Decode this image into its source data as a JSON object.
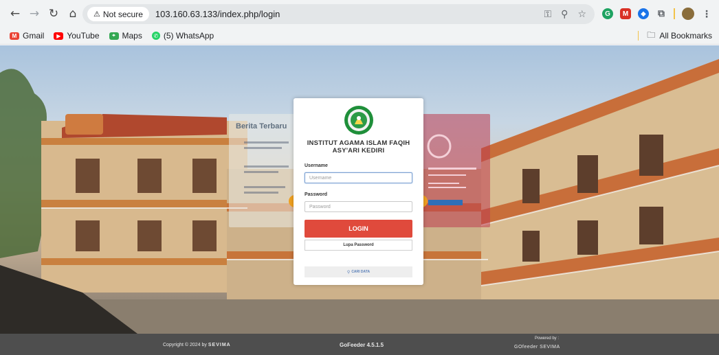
{
  "browser": {
    "security_label": "Not secure",
    "url": "103.160.63.133/index.php/login",
    "bookmarks": [
      {
        "label": "Gmail",
        "color": "#ea4335"
      },
      {
        "label": "YouTube",
        "color": "#ff0000"
      },
      {
        "label": "Maps",
        "color": "#34a853"
      },
      {
        "label": "(5) WhatsApp",
        "color": "#25d366"
      }
    ],
    "all_bookmarks": "All Bookmarks"
  },
  "slides": {
    "left_title": "Berita Terbaru"
  },
  "login": {
    "institution": "INSTITUT AGAMA ISLAM FAQIH ASY'ARI KEDIRI",
    "username_label": "Username",
    "username_placeholder": "Username",
    "password_label": "Password",
    "password_placeholder": "Password",
    "login_button": "LOGIN",
    "forgot_button": "Lupa Password",
    "search_button": "CARI DATA",
    "accent_color": "#e04a3c"
  },
  "footer": {
    "copyright": "Copyright © 2024 by",
    "copyright_brand": "SEVIMA",
    "version": "GoFeeder 4.5.1.5",
    "powered_by": "Powered by :",
    "powered_brand": "GOfeeder SEVIMA"
  }
}
